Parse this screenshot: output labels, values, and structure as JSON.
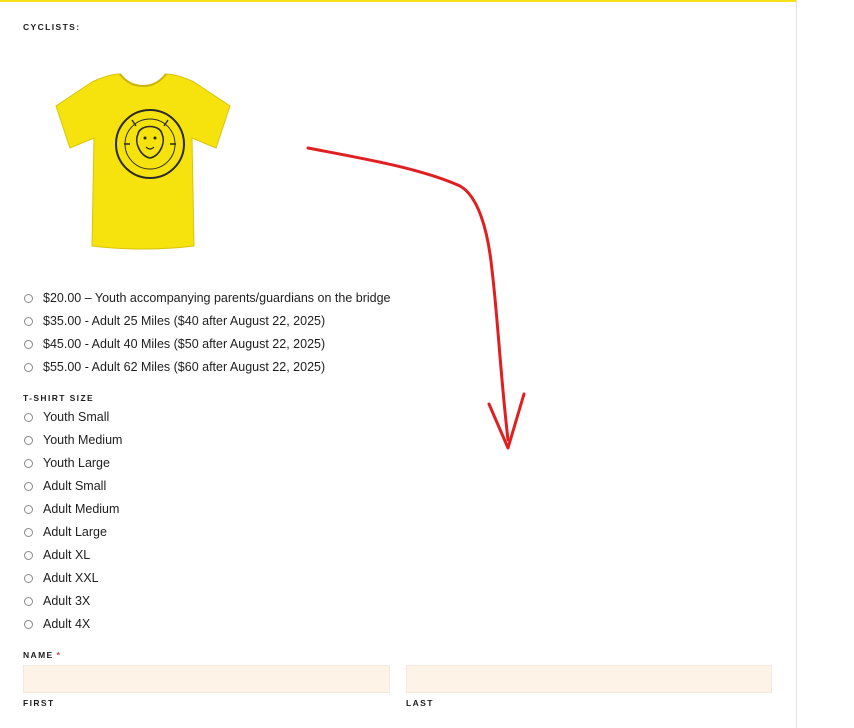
{
  "header": {
    "section_title": "CYCLISTS:"
  },
  "colors": {
    "accent": "#f6e017",
    "shirt": "#f6e20c",
    "field_bg": "#fdf3e7",
    "required": "#d63638",
    "annotation": "#e02020"
  },
  "product_image": {
    "icon": "yellow-tshirt-lion-logo"
  },
  "registration_options": [
    {
      "label": "$20.00 – Youth accompanying parents/guardians on the bridge"
    },
    {
      "label": "$35.00 - Adult 25 Miles ($40 after August 22, 2025)"
    },
    {
      "label": "$45.00 - Adult 40 Miles ($50 after August 22, 2025)"
    },
    {
      "label": "$55.00 - Adult 62 Miles ($60 after August 22, 2025)"
    }
  ],
  "tshirt_size": {
    "label": "T-SHIRT SIZE",
    "options": [
      {
        "label": "Youth Small"
      },
      {
        "label": "Youth Medium"
      },
      {
        "label": "Youth Large"
      },
      {
        "label": "Adult Small"
      },
      {
        "label": "Adult Medium"
      },
      {
        "label": "Adult Large"
      },
      {
        "label": "Adult XL"
      },
      {
        "label": "Adult XXL"
      },
      {
        "label": "Adult 3X"
      },
      {
        "label": "Adult 4X"
      }
    ]
  },
  "name_field": {
    "label": "NAME",
    "required_marker": "*",
    "first_value": "",
    "last_value": "",
    "first_label": "FIRST",
    "last_label": "LAST"
  }
}
